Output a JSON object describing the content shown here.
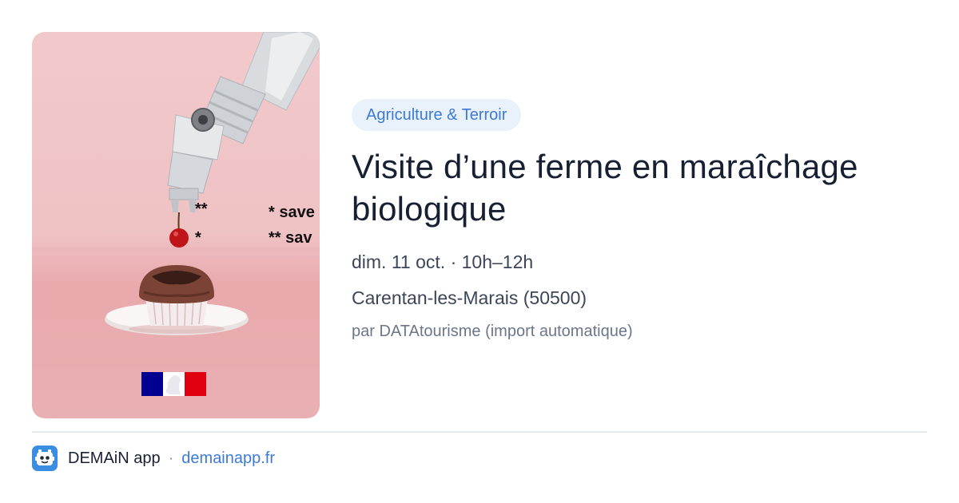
{
  "image": {
    "asterisk_double": "**",
    "asterisk_single": "*",
    "cropped_text_1": "* save",
    "cropped_text_2": "** sav"
  },
  "category": "Agriculture & Terroir",
  "title": "Visite d’une ferme en maraîchage biologique",
  "datetime": "dim. 11 oct. · 10h–12h",
  "location": "Carentan-les-Marais (50500)",
  "source": "par DATAtourisme (import automatique)",
  "footer": {
    "app_name": "DEMAiN app",
    "separator": "·",
    "url": "demainapp.fr"
  },
  "colors": {
    "accent": "#3d7ad6",
    "badge_bg": "#e9f1fb",
    "title": "#172033",
    "image_bg": "#f2c9cb",
    "logo_bg": "#3a8de0"
  }
}
